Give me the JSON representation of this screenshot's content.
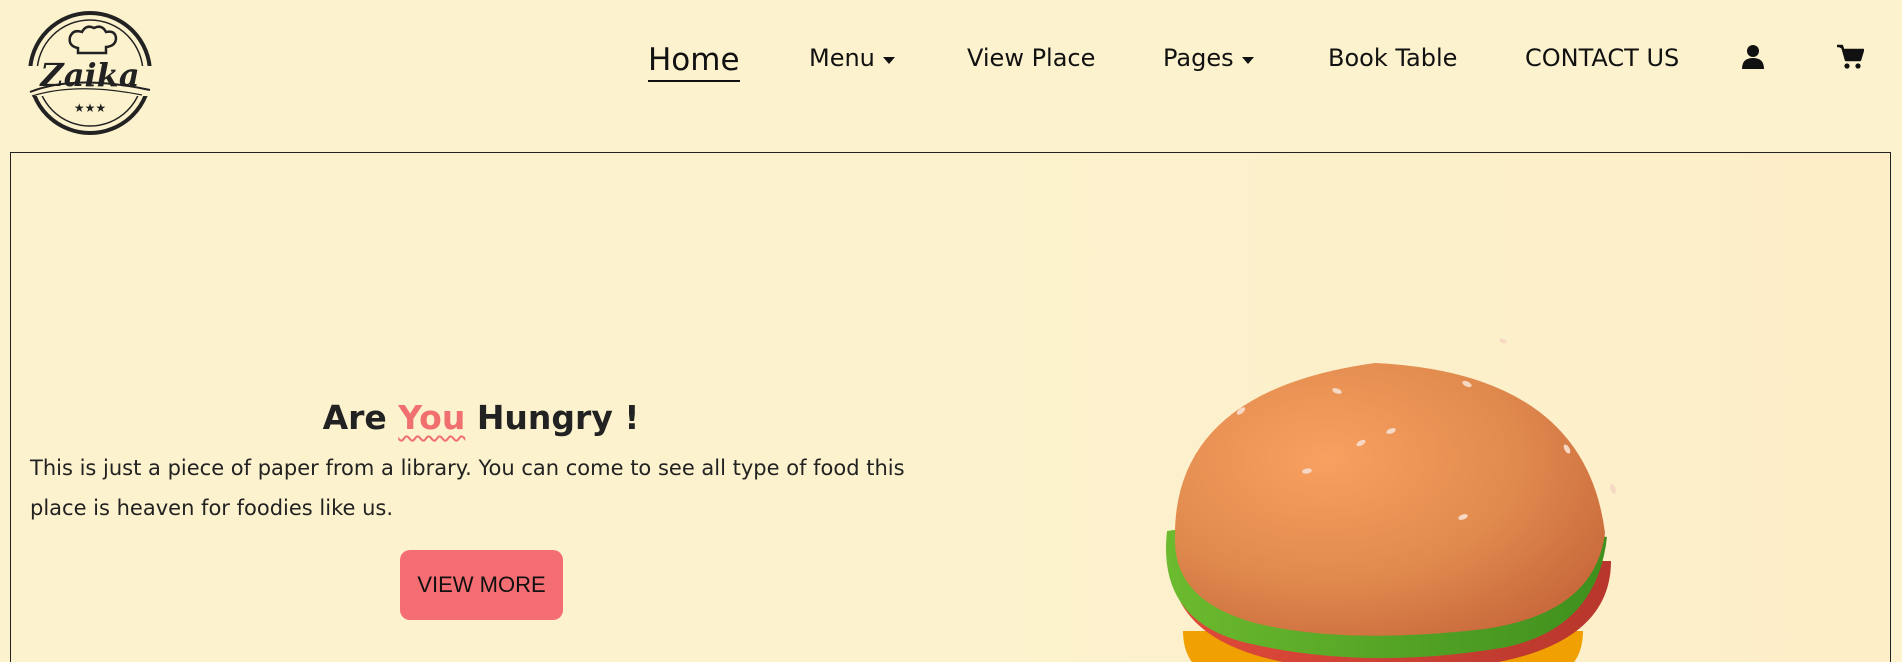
{
  "brand": {
    "logo_text": "Zaika",
    "logo_icon": "chef-hat-logo-icon"
  },
  "nav": {
    "home": "Home",
    "menu": "Menu",
    "view_place": "View Place",
    "pages": "Pages",
    "book_table": "Book Table",
    "contact": "CONTACT US",
    "user_icon": "user-icon",
    "cart_icon": "cart-icon",
    "caret_icon": "caret-down-icon"
  },
  "hero": {
    "title_before": "Are ",
    "title_accent": "You",
    "title_after": " Hungry !",
    "description": "This is just a piece of paper from a library. You can come to see all type of food this place is heaven for foodies like us.",
    "button_label": "VIEW MORE",
    "image_icon": "burger-illustration"
  },
  "colors": {
    "background": "#fcf2cd",
    "accent": "#f07070",
    "button": "#f46d72",
    "text": "#222222"
  }
}
